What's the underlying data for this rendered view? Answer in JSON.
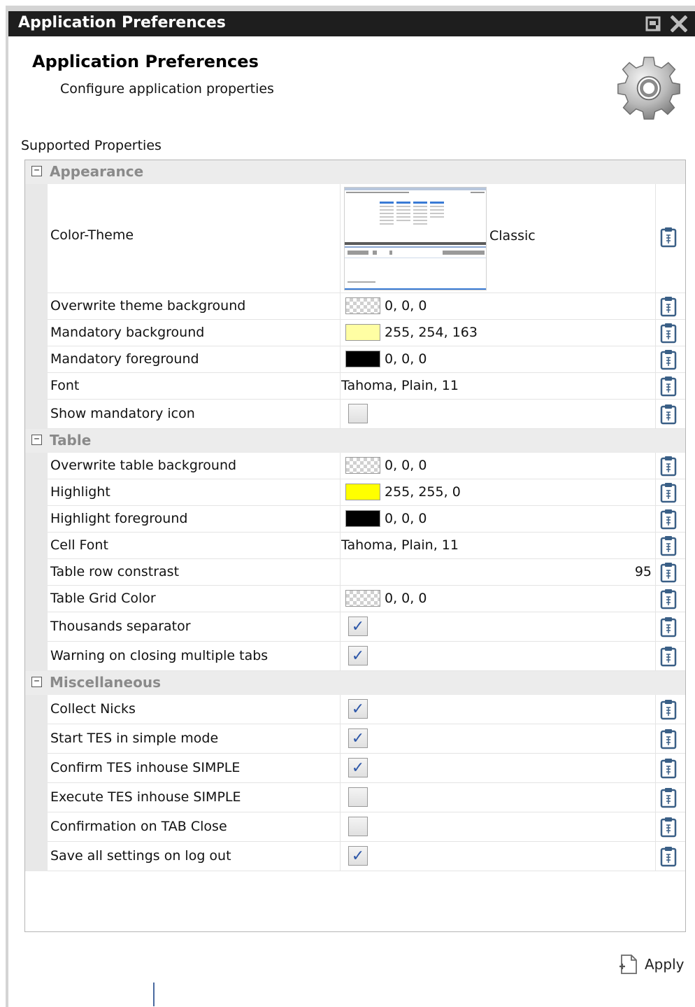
{
  "window": {
    "title": "Application Preferences"
  },
  "header": {
    "title": "Application Preferences",
    "subtitle": "Configure application properties",
    "icon": "gear-icon"
  },
  "grid": {
    "label": "Supported Properties",
    "categories": [
      {
        "label": "Appearance",
        "toggle": "⊟",
        "rows": [
          {
            "name": "Color-Theme",
            "value": "Classic",
            "type": "theme"
          },
          {
            "name": "Overwrite theme background",
            "value": "0, 0, 0",
            "type": "color",
            "swatch": "transparent"
          },
          {
            "name": "Mandatory background",
            "value": "255, 254, 163",
            "type": "color",
            "swatch": "#fffea3"
          },
          {
            "name": "Mandatory foreground",
            "value": "0, 0, 0",
            "type": "color",
            "swatch": "#000000"
          },
          {
            "name": "Font",
            "value": "Tahoma, Plain, 11",
            "type": "text"
          },
          {
            "name": "Show mandatory icon",
            "checked": false,
            "type": "checkbox"
          }
        ]
      },
      {
        "label": "Table",
        "toggle": "⊟",
        "rows": [
          {
            "name": "Overwrite table background",
            "value": "0, 0, 0",
            "type": "color",
            "swatch": "transparent"
          },
          {
            "name": "Highlight",
            "value": "255, 255, 0",
            "type": "color",
            "swatch": "#ffff00"
          },
          {
            "name": "Highlight foreground",
            "value": "0, 0, 0",
            "type": "color",
            "swatch": "#000000"
          },
          {
            "name": "Cell Font",
            "value": "Tahoma, Plain, 11",
            "type": "text"
          },
          {
            "name": "Table row constrast",
            "value": "95",
            "type": "number"
          },
          {
            "name": "Table Grid Color",
            "value": "0, 0, 0",
            "type": "color",
            "swatch": "transparent"
          },
          {
            "name": "Thousands separator",
            "checked": true,
            "type": "checkbox"
          },
          {
            "name": "Warning on closing multiple tabs",
            "checked": true,
            "type": "checkbox"
          }
        ]
      },
      {
        "label": "Miscellaneous",
        "toggle": "⊟",
        "rows": [
          {
            "name": "Collect Nicks",
            "checked": true,
            "type": "checkbox"
          },
          {
            "name": "Start TES in simple mode",
            "checked": true,
            "type": "checkbox"
          },
          {
            "name": "Confirm TES inhouse SIMPLE",
            "checked": true,
            "type": "checkbox"
          },
          {
            "name": "Execute TES inhouse SIMPLE",
            "checked": false,
            "type": "checkbox"
          },
          {
            "name": "Confirmation on TAB Close",
            "checked": false,
            "type": "checkbox"
          },
          {
            "name": "Save all settings on log out",
            "checked": true,
            "type": "checkbox"
          }
        ]
      }
    ]
  },
  "footer": {
    "apply_label": "Apply"
  }
}
